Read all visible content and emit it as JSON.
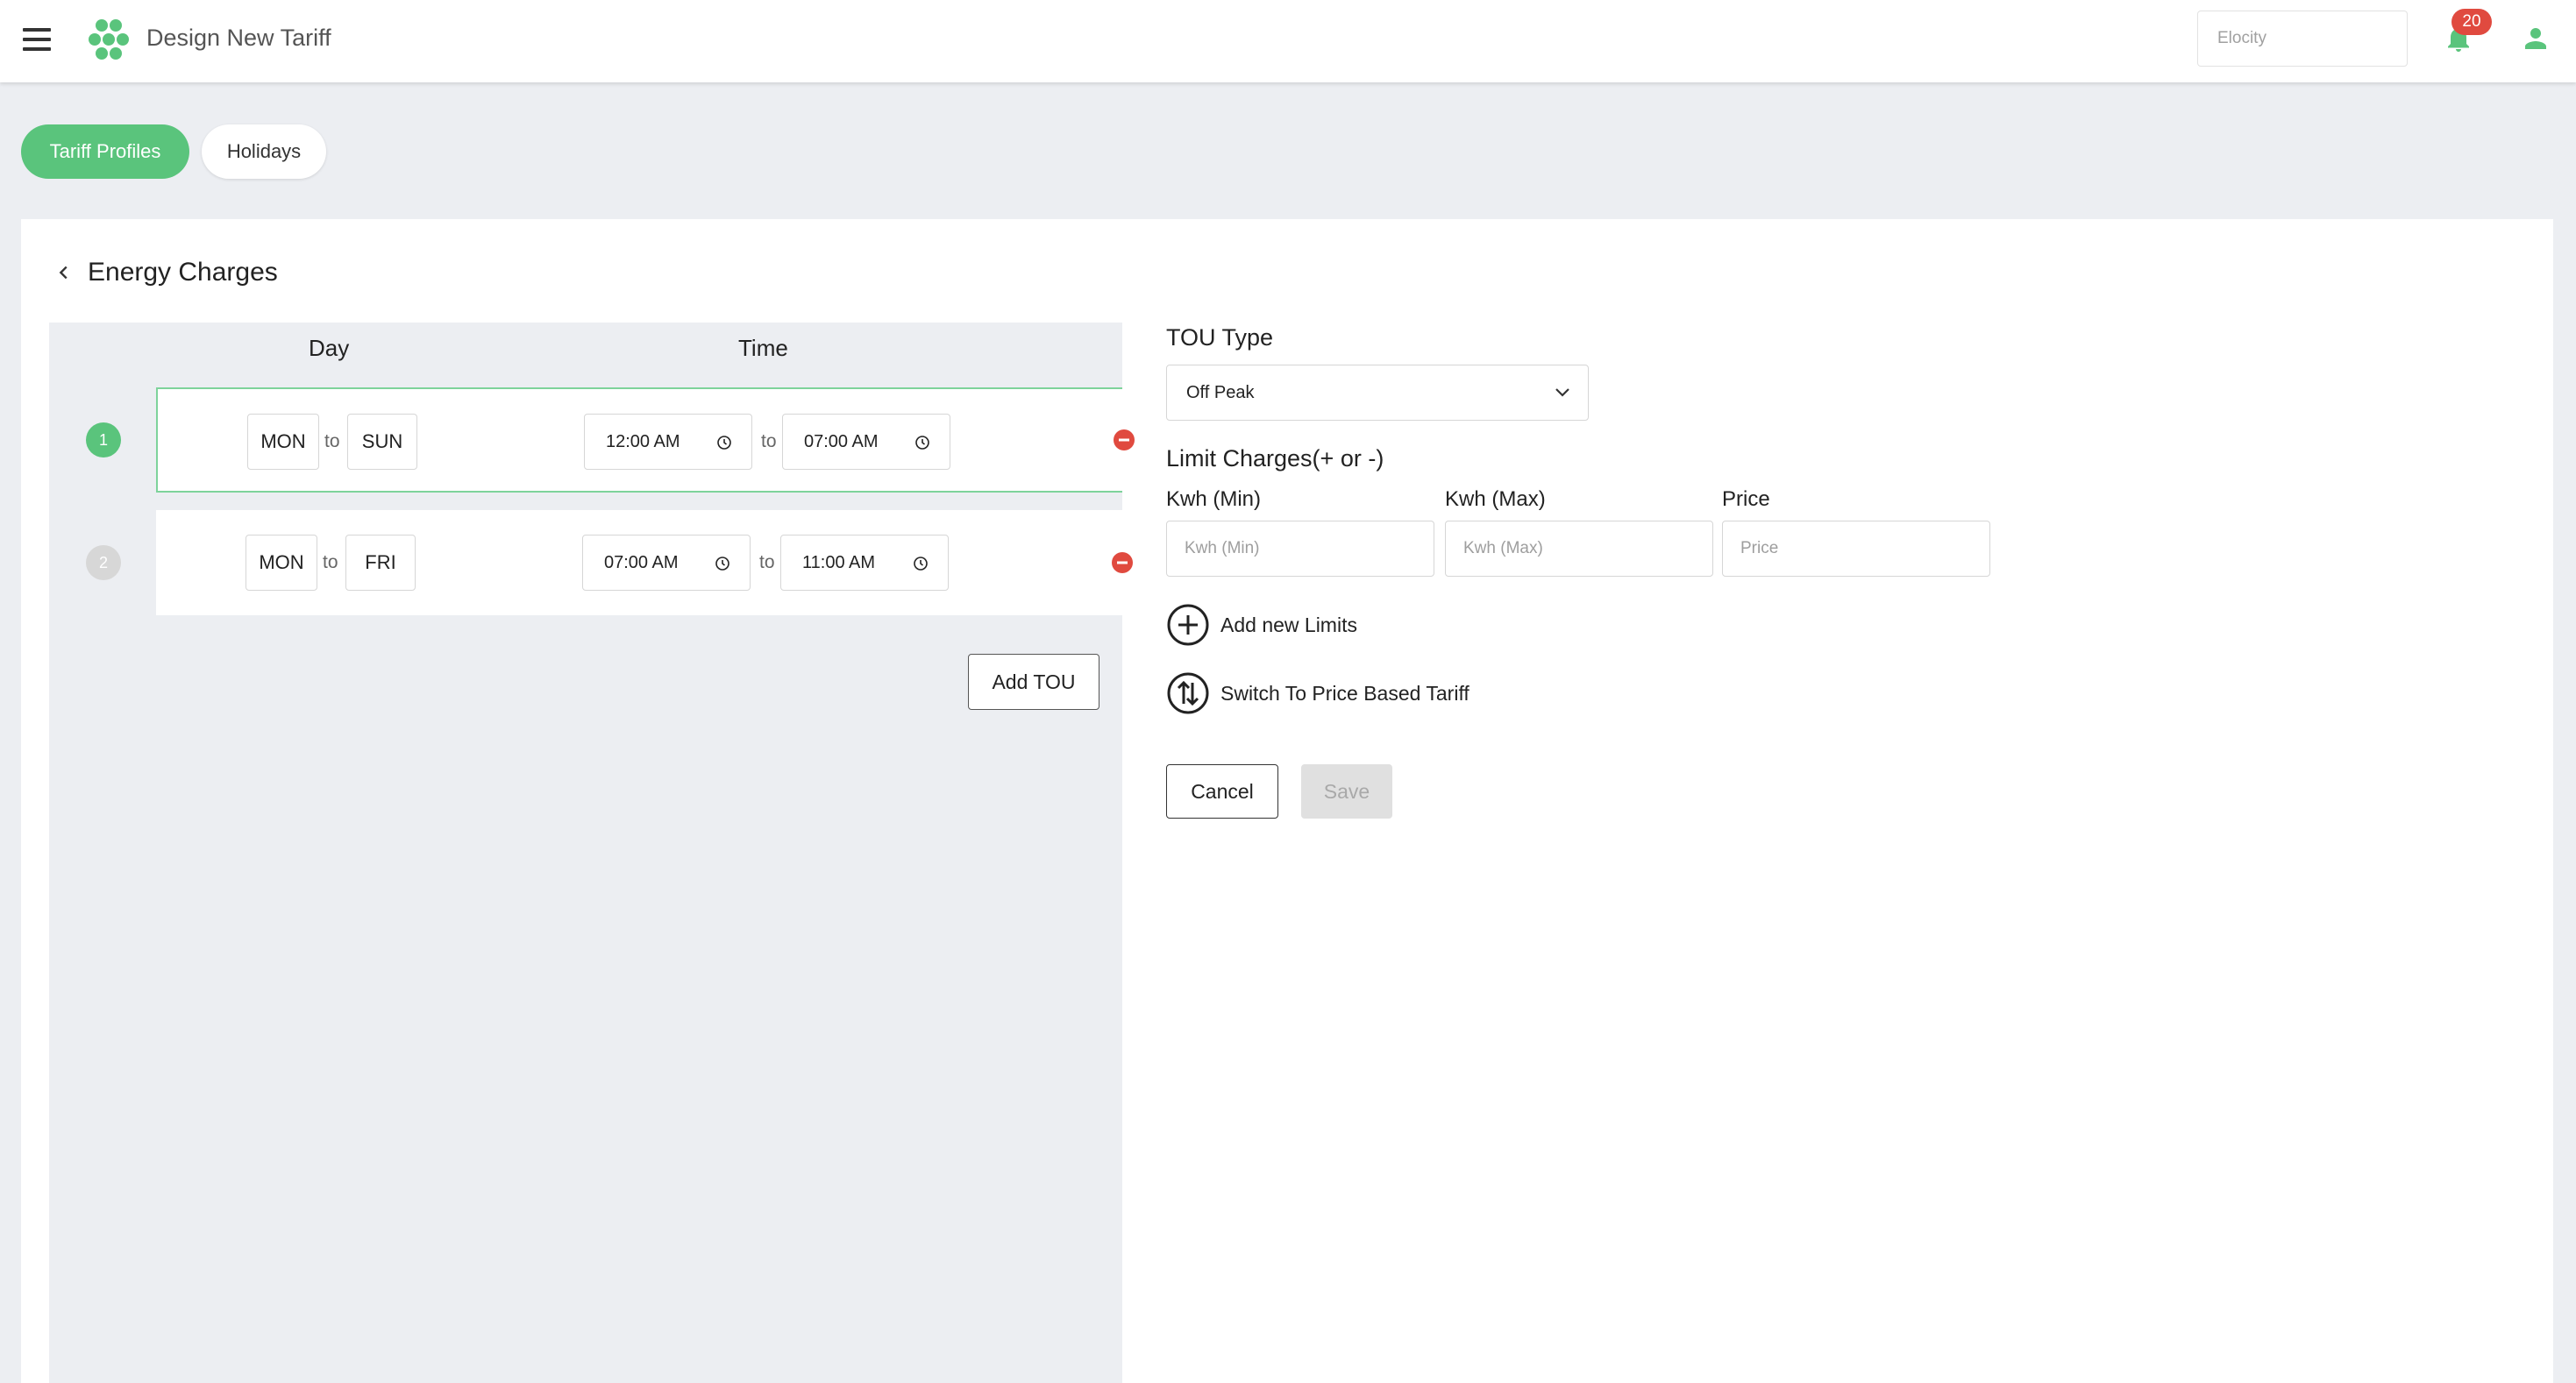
{
  "header": {
    "title": "Design New Tariff",
    "search_placeholder": "Elocity",
    "notification_count": "20"
  },
  "tabs": [
    {
      "label": "Tariff Profiles",
      "active": true
    },
    {
      "label": "Holidays",
      "active": false
    }
  ],
  "card": {
    "title": "Energy Charges",
    "columns": {
      "day": "Day",
      "time": "Time"
    },
    "rows": [
      {
        "index": "1",
        "day_from": "MON",
        "to_1": "to",
        "day_to": "SUN",
        "time_from": "12:00 AM",
        "to_2": "to",
        "time_to": "07:00 AM",
        "active": true
      },
      {
        "index": "2",
        "day_from": "MON",
        "to_1": "to",
        "day_to": "FRI",
        "time_from": "07:00 AM",
        "to_2": "to",
        "time_to": "11:00 AM",
        "active": false
      }
    ],
    "add_tou_label": "Add TOU"
  },
  "tou": {
    "type_label": "TOU Type",
    "type_value": "Off Peak",
    "limit_label": "Limit Charges(+ or -)",
    "fields": [
      {
        "label": "Kwh (Min)",
        "placeholder": "Kwh (Min)"
      },
      {
        "label": "Kwh (Max)",
        "placeholder": "Kwh (Max)"
      },
      {
        "label": "Price",
        "placeholder": "Price"
      }
    ],
    "add_limits_label": "Add new Limits",
    "switch_label": "Switch To Price Based Tariff",
    "cancel_label": "Cancel",
    "save_label": "Save"
  },
  "colors": {
    "accent": "#5ac47c",
    "danger": "#e04a3f",
    "background": "#eceef2"
  }
}
